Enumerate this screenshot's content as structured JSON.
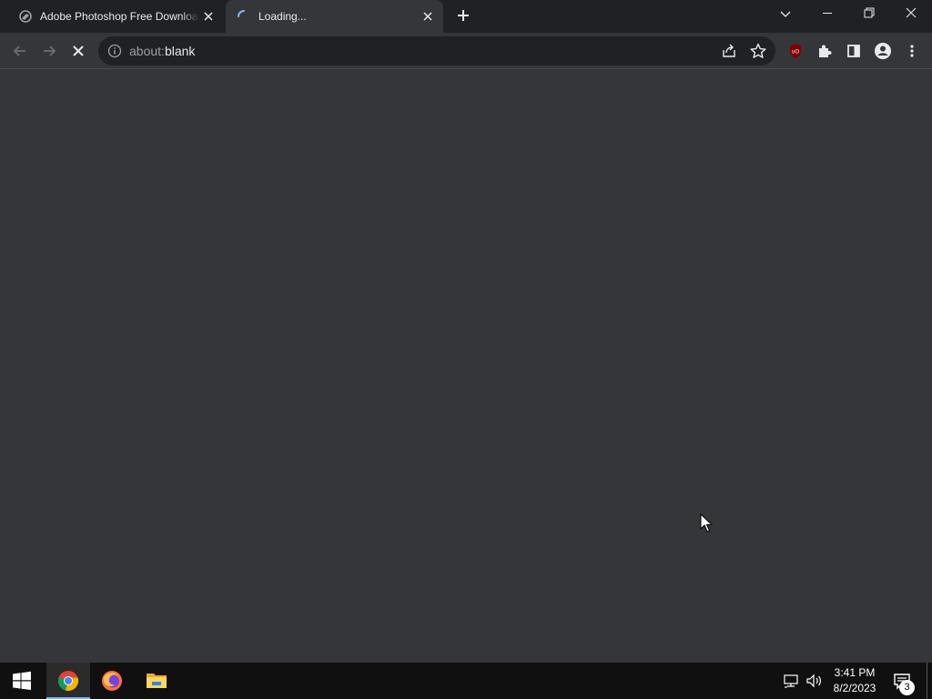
{
  "browser": {
    "tabs": [
      {
        "title": "Adobe Photoshop Free Download",
        "active": false
      },
      {
        "title": "Loading...",
        "active": true
      }
    ],
    "address_bar": {
      "scheme": "about:",
      "host": "blank"
    }
  },
  "taskbar": {
    "apps": [
      "Start",
      "Google Chrome",
      "Firefox",
      "File Explorer"
    ],
    "active_app": "Google Chrome",
    "clock": {
      "time": "3:41 PM",
      "date": "8/2/2023"
    },
    "notification_count": "3"
  },
  "colors": {
    "titlebar": "#202124",
    "toolbar": "#35363a",
    "page_background": "#35363a",
    "taskbar": "#101010",
    "accent": "#76b9ed"
  },
  "icons": [
    "app-favicon-icon",
    "loading-spinner-icon",
    "close-icon",
    "plus-icon",
    "chevron-down-icon",
    "minimize-icon",
    "restore-icon",
    "back-arrow-icon",
    "forward-arrow-icon",
    "stop-icon",
    "info-icon",
    "share-icon",
    "star-icon",
    "ublock-icon",
    "puzzle-icon",
    "side-panel-icon",
    "profile-icon",
    "more-vert-icon",
    "windows-logo-icon",
    "chrome-icon",
    "firefox-icon",
    "folder-icon",
    "network-icon",
    "volume-icon",
    "notification-icon",
    "mouse-cursor-icon"
  ]
}
